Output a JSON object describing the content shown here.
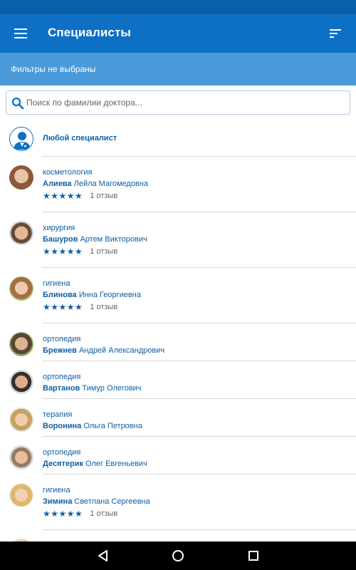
{
  "app_bar": {
    "title": "Специалисты",
    "menu_icon": "menu-icon",
    "sort_icon": "sort-icon"
  },
  "filter_bar": {
    "text": "Фильтры не выбраны"
  },
  "search": {
    "placeholder": "Поиск по фамилии доктора..."
  },
  "any_specialist": {
    "label": "Любой специалист"
  },
  "doctors": [
    {
      "specialty": "косметология",
      "surname": "Алиева",
      "given": "Лейла Магомедовна",
      "stars": "★★★★★",
      "reviews": "1 отзыв"
    },
    {
      "specialty": "хирургия",
      "surname": "Башуров",
      "given": "Артем Викторович",
      "stars": "★★★★★",
      "reviews": "1 отзыв"
    },
    {
      "specialty": "гигиена",
      "surname": "Блинова",
      "given": "Инна Георгиевна",
      "stars": "★★★★★",
      "reviews": "1 отзыв"
    },
    {
      "specialty": "ортопедия",
      "surname": "Брежнев",
      "given": "Андрей Александрович"
    },
    {
      "specialty": "ортопедия",
      "surname": "Вартанов",
      "given": "Тимур Олегович"
    },
    {
      "specialty": "терапия",
      "surname": "Воронина",
      "given": "Ольга Петровна"
    },
    {
      "specialty": "ортопедия",
      "surname": "Десятерик",
      "given": "Олег Евгеньевич"
    },
    {
      "specialty": "гигиена",
      "surname": "Зимина",
      "given": "Светлана Сергеевна",
      "stars": "★★★★★",
      "reviews": "1 отзыв"
    }
  ],
  "colors": {
    "primary": "#0d70c4",
    "filter_bar": "#4a9ad9",
    "text_accent": "#0d5fa8"
  },
  "nav": {
    "back_icon": "back-icon",
    "home_icon": "home-icon",
    "recents_icon": "recents-icon"
  }
}
